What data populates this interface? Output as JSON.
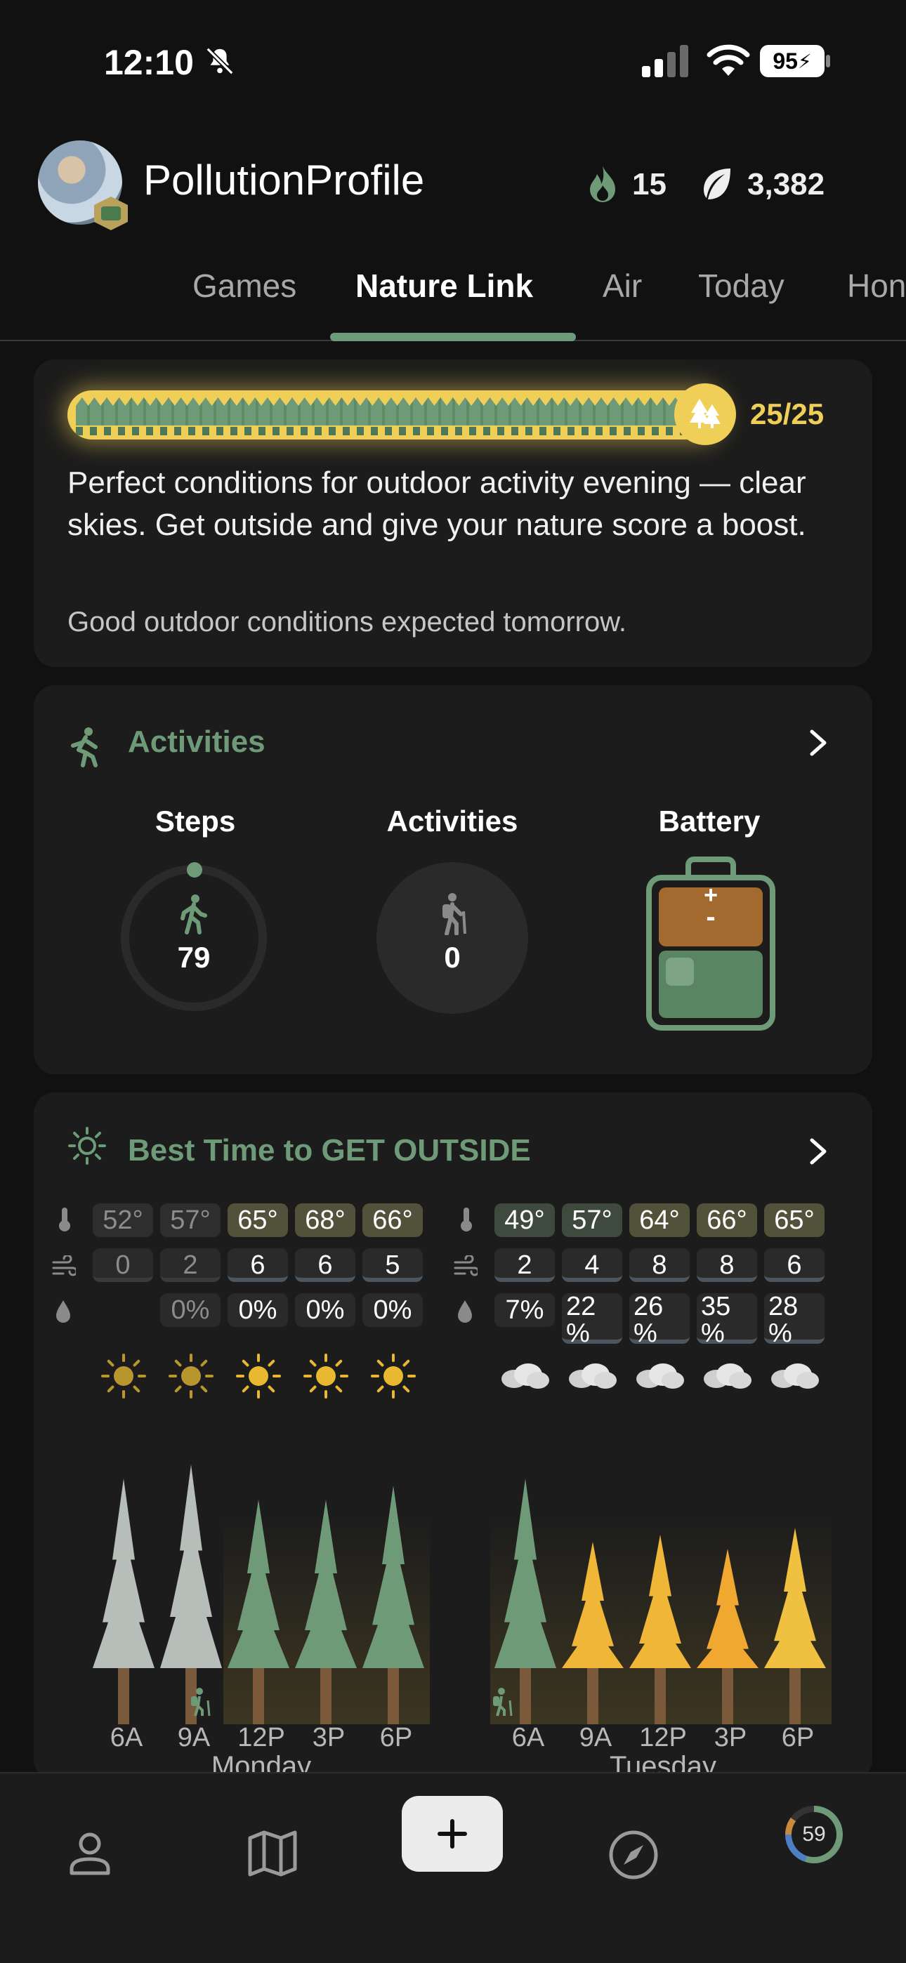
{
  "status_bar": {
    "time": "12:10",
    "battery": "95"
  },
  "header": {
    "profile_name": "PollutionProfile",
    "streak": "15",
    "points": "3,382"
  },
  "tabs": [
    {
      "label": "Games",
      "active": false
    },
    {
      "label": "Nature Link",
      "active": true
    },
    {
      "label": "Air",
      "active": false
    },
    {
      "label": "Today",
      "active": false
    },
    {
      "label": "Hon",
      "active": false
    }
  ],
  "nature": {
    "score_text": "25/25",
    "score_fraction": 1.0,
    "description": "Perfect conditions for outdoor activity evening — clear skies. Get outside and give your nature score a boost.",
    "subtext": "Good outdoor conditions expected tomorrow."
  },
  "activities": {
    "title": "Activities",
    "steps_label": "Steps",
    "steps_value": "79",
    "activities_label": "Activities",
    "activities_value": "0",
    "battery_label": "Battery",
    "battery_plus": "+",
    "battery_minus": "-"
  },
  "best_time": {
    "title": "Best Time to GET OUTSIDE",
    "days": [
      {
        "name": "Monday",
        "times": [
          "6A",
          "9A",
          "12P",
          "3P",
          "6P"
        ],
        "temps": [
          "52°",
          "57°",
          "65°",
          "68°",
          "66°"
        ],
        "wind": [
          "0",
          "2",
          "6",
          "6",
          "5"
        ],
        "rain": [
          "",
          "0%",
          "0%",
          "0%",
          "0%"
        ],
        "weather": [
          "sun",
          "sun",
          "sun",
          "sun",
          "sun"
        ]
      },
      {
        "name": "Tuesday",
        "times": [
          "6A",
          "9A",
          "12P",
          "3P",
          "6P"
        ],
        "temps": [
          "49°",
          "57°",
          "64°",
          "66°",
          "65°"
        ],
        "wind": [
          "2",
          "4",
          "8",
          "8",
          "6"
        ],
        "rain": [
          "7%",
          "22 %",
          "26 %",
          "35 %",
          "28 %"
        ],
        "weather": [
          "cloud",
          "cloud",
          "cloud",
          "cloud",
          "cloud"
        ]
      }
    ]
  },
  "bottom_nav": {
    "score": "59"
  },
  "colors": {
    "accent": "#6f9a77",
    "gold": "#f0cf58",
    "background": "#111111",
    "card": "#1c1c1c"
  }
}
